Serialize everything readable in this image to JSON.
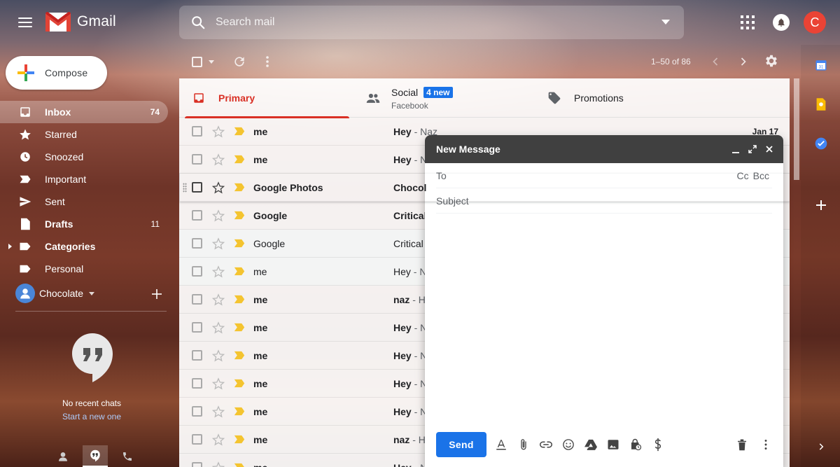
{
  "header": {
    "app_name": "Gmail",
    "search_placeholder": "Search mail",
    "avatar_letter": "C",
    "icons": [
      "menu-icon",
      "search-icon",
      "apps-icon",
      "notifications-icon"
    ]
  },
  "colors": {
    "gmail_red": "#d93025",
    "accent_blue": "#1a73e8",
    "avatar_red": "#ea4335",
    "important_yellow": "#f4c430"
  },
  "sidebar": {
    "compose_label": "Compose",
    "items": [
      {
        "label": "Inbox",
        "count": "74",
        "icon": "inbox-icon"
      },
      {
        "label": "Starred",
        "count": "",
        "icon": "star-icon"
      },
      {
        "label": "Snoozed",
        "count": "",
        "icon": "clock-icon"
      },
      {
        "label": "Important",
        "count": "",
        "icon": "important-icon"
      },
      {
        "label": "Sent",
        "count": "",
        "icon": "send-icon"
      },
      {
        "label": "Drafts",
        "count": "11",
        "icon": "draft-icon"
      },
      {
        "label": "Categories",
        "count": "",
        "icon": "label-icon"
      },
      {
        "label": "Personal",
        "count": "",
        "icon": "label-icon"
      }
    ],
    "hangouts_user": "Chocolate",
    "no_chats": "No recent chats",
    "start_chat": "Start a new one"
  },
  "toolbar": {
    "pagination": "1–50 of 86"
  },
  "tabs": {
    "primary": "Primary",
    "social": "Social",
    "social_badge": "4 new",
    "social_sub": "Facebook",
    "promotions": "Promotions"
  },
  "emails": [
    {
      "sender": "me",
      "subject": "Hey",
      "snippet": " - Naz",
      "date": "Jan 17",
      "unread": true
    },
    {
      "sender": "me",
      "subject": "Hey",
      "snippet": " - N",
      "date": "",
      "unread": true
    },
    {
      "sender": "Google Photos",
      "subject": "Chocol",
      "snippet": "",
      "date": "",
      "unread": true
    },
    {
      "sender": "Google",
      "subject": "Critical",
      "snippet": "",
      "date": "",
      "unread": true
    },
    {
      "sender": "Google",
      "subject": "Critical",
      "snippet": "",
      "date": "",
      "unread": false
    },
    {
      "sender": "me",
      "subject": "Hey",
      "snippet": " - N",
      "date": "",
      "unread": false
    },
    {
      "sender": "me",
      "subject": "naz",
      "snippet": " - H",
      "date": "",
      "unread": true
    },
    {
      "sender": "me",
      "subject": "Hey",
      "snippet": " - N",
      "date": "",
      "unread": true
    },
    {
      "sender": "me",
      "subject": "Hey",
      "snippet": " - N",
      "date": "",
      "unread": true
    },
    {
      "sender": "me",
      "subject": "Hey",
      "snippet": " - N",
      "date": "",
      "unread": true
    },
    {
      "sender": "me",
      "subject": "Hey",
      "snippet": " - N",
      "date": "",
      "unread": true
    },
    {
      "sender": "me",
      "subject": "naz",
      "snippet": " - H",
      "date": "",
      "unread": true
    },
    {
      "sender": "me",
      "subject": "Hey",
      "snippet": " - N",
      "date": "",
      "unread": true
    }
  ],
  "compose_window": {
    "title": "New Message",
    "to_label": "To",
    "cc": "Cc",
    "bcc": "Bcc",
    "subject_placeholder": "Subject",
    "send_label": "Send"
  }
}
